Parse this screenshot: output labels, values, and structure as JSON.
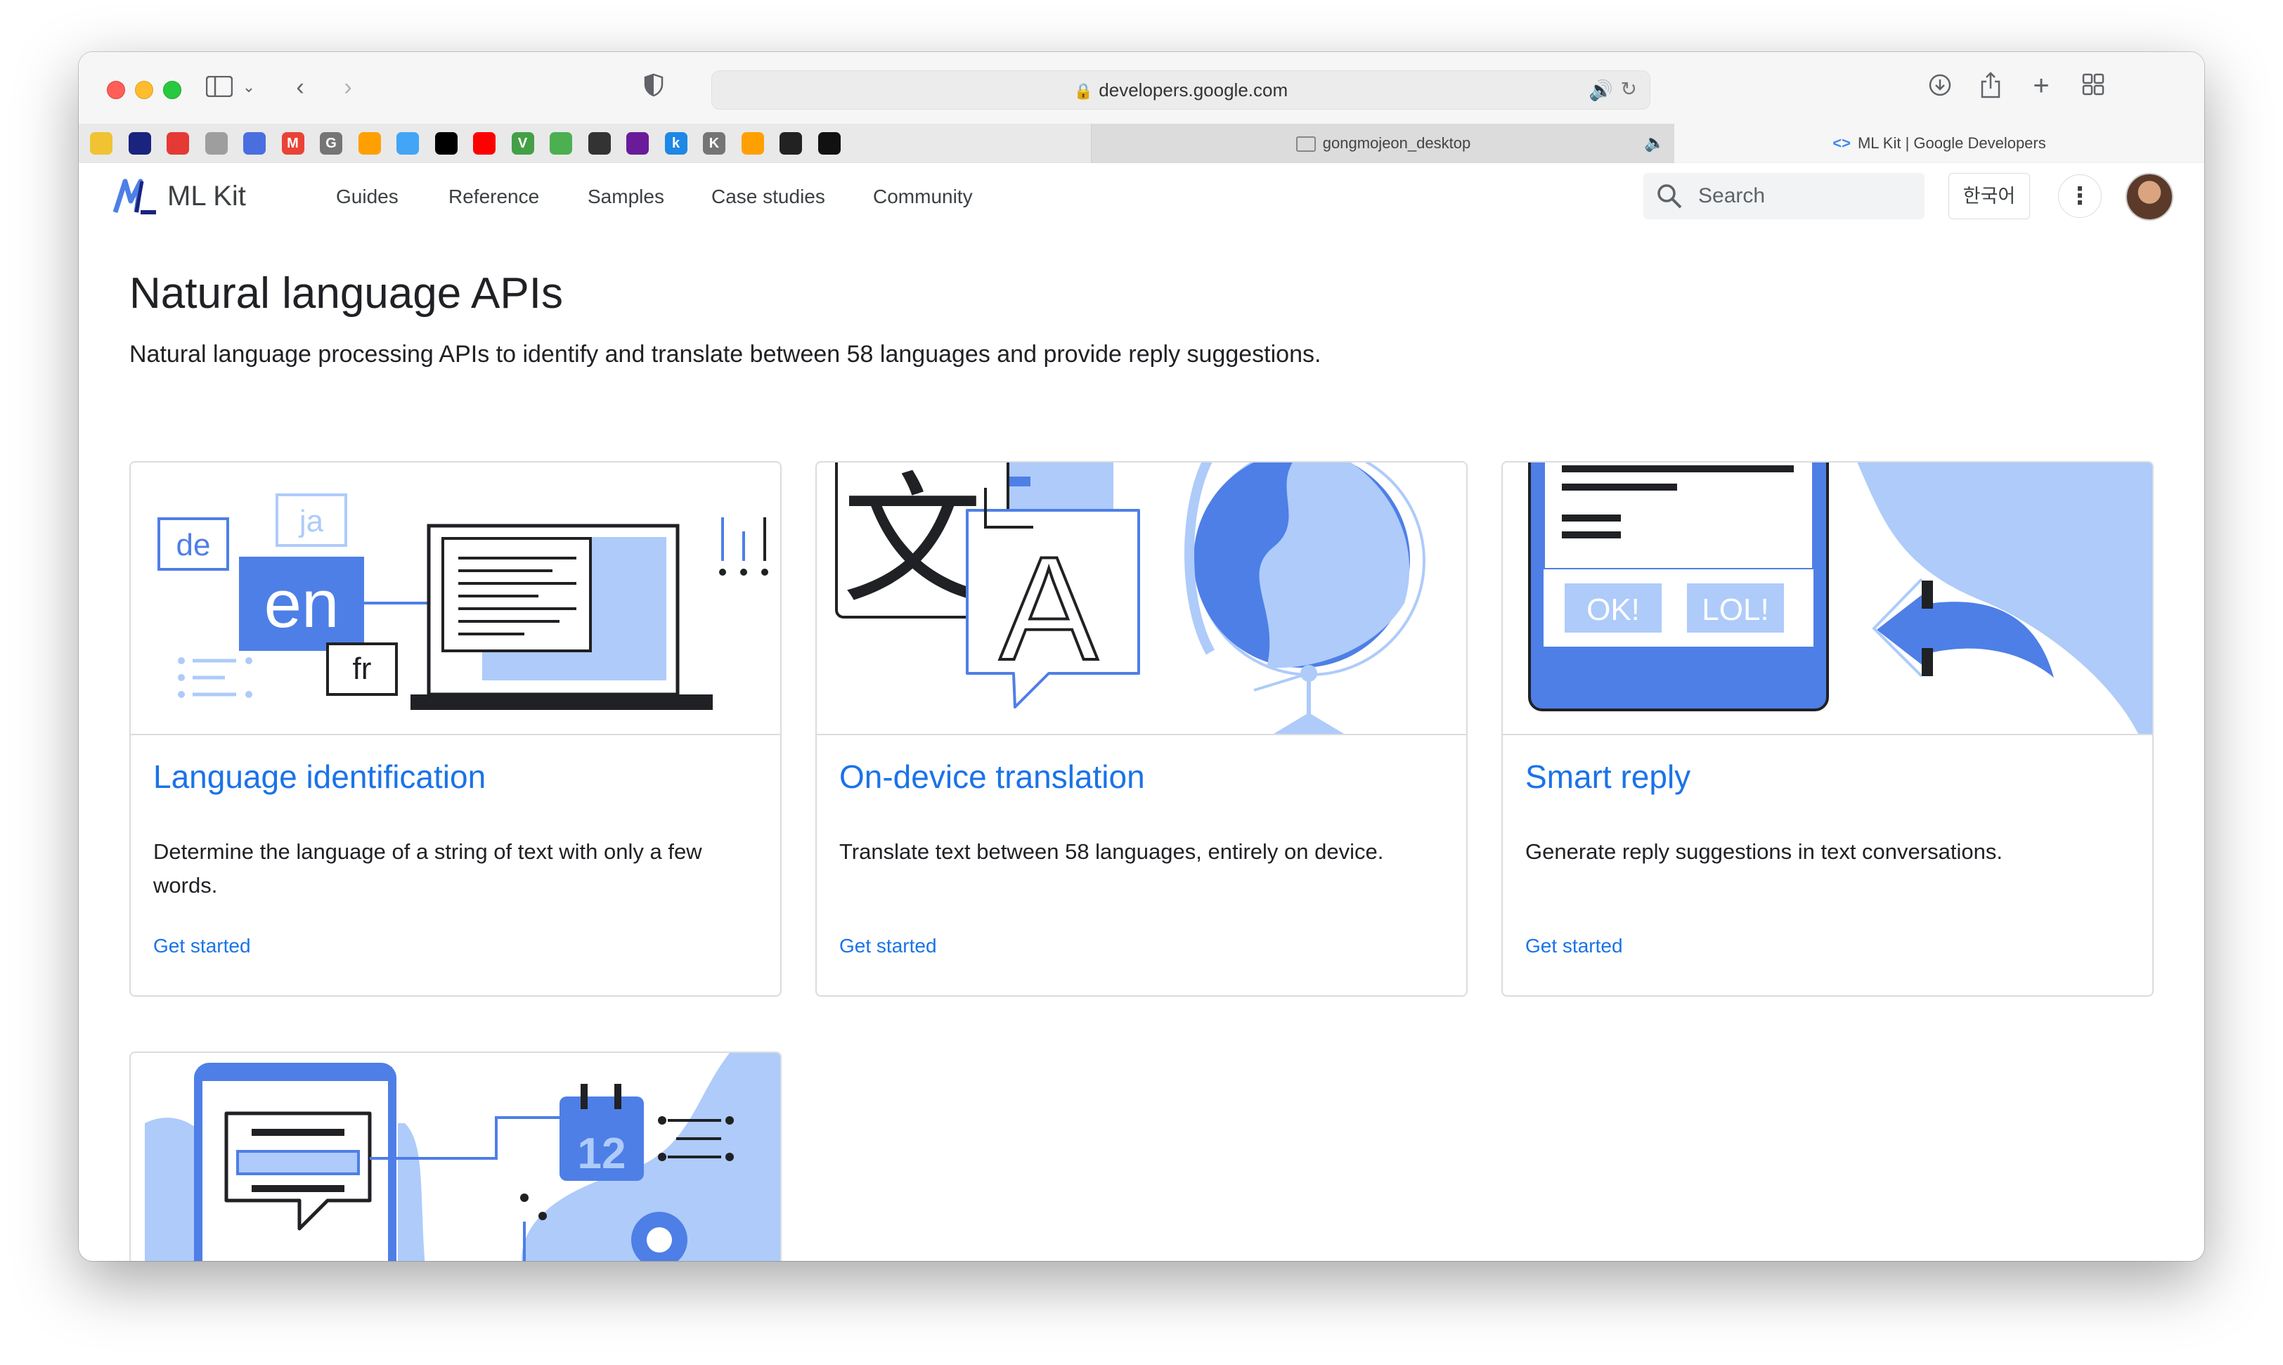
{
  "browser": {
    "url": "developers.google.com",
    "tabs": [
      {
        "label": "gongmojeon_desktop",
        "audio": true
      },
      {
        "label": "ML Kit  |  Google Developers",
        "active": true
      }
    ],
    "pinned_tabs": [
      {
        "name": "pinned-1",
        "letter": "",
        "color": "#f1c232"
      },
      {
        "name": "pinned-2",
        "letter": "",
        "color": "#1a237e"
      },
      {
        "name": "pinned-3",
        "letter": "",
        "color": "#e53935"
      },
      {
        "name": "pinned-4",
        "letter": "",
        "color": "#9e9e9e"
      },
      {
        "name": "pinned-5",
        "letter": "",
        "color": "#4a6ee0"
      },
      {
        "name": "pinned-gmail",
        "letter": "M",
        "color": "#ea4335"
      },
      {
        "name": "pinned-g",
        "letter": "G",
        "color": "#757575"
      },
      {
        "name": "pinned-firebase-1",
        "letter": "",
        "color": "#ffa000"
      },
      {
        "name": "pinned-person",
        "letter": "",
        "color": "#42a5f5"
      },
      {
        "name": "pinned-medium",
        "letter": "",
        "color": "#000000"
      },
      {
        "name": "pinned-youtube",
        "letter": "",
        "color": "#ff0000"
      },
      {
        "name": "pinned-v",
        "letter": "V",
        "color": "#43a047"
      },
      {
        "name": "pinned-blog",
        "letter": "",
        "color": "#4caf50"
      },
      {
        "name": "pinned-dots",
        "letter": "",
        "color": "#333333"
      },
      {
        "name": "pinned-circle",
        "letter": "",
        "color": "#6a1b9a"
      },
      {
        "name": "pinned-k-blue",
        "letter": "k",
        "color": "#1e88e5"
      },
      {
        "name": "pinned-k-grey",
        "letter": "K",
        "color": "#757575"
      },
      {
        "name": "pinned-firebase-2",
        "letter": "",
        "color": "#ffa000"
      },
      {
        "name": "pinned-openai",
        "letter": "",
        "color": "#222222"
      },
      {
        "name": "pinned-github",
        "letter": "",
        "color": "#111111"
      }
    ]
  },
  "site": {
    "logo_text": "ML Kit",
    "nav": [
      "Guides",
      "Reference",
      "Samples",
      "Case studies",
      "Community"
    ],
    "search_placeholder": "Search",
    "language_button": "한국어"
  },
  "page": {
    "title": "Natural language APIs",
    "description": "Natural language processing APIs to identify and translate between 58 languages and provide reply suggestions."
  },
  "cards": [
    {
      "title": "Language identification",
      "description": "Determine the language of a string of text with only a few words.",
      "link": "Get started",
      "art_text": [
        "de",
        "ja",
        "en",
        "fr"
      ]
    },
    {
      "title": "On-device translation",
      "description": "Translate text between 58 languages, entirely on device.",
      "link": "Get started",
      "art_text": [
        "文",
        "A"
      ]
    },
    {
      "title": "Smart reply",
      "description": "Generate reply suggestions in text conversations.",
      "link": "Get started",
      "art_text": [
        "OK!",
        "LOL!"
      ]
    },
    {
      "art_text": [
        "12"
      ]
    }
  ],
  "colors": {
    "link_blue": "#1a73e8",
    "illustration_blue": "#4e7fe6",
    "illustration_light_blue": "#aecbfa"
  }
}
